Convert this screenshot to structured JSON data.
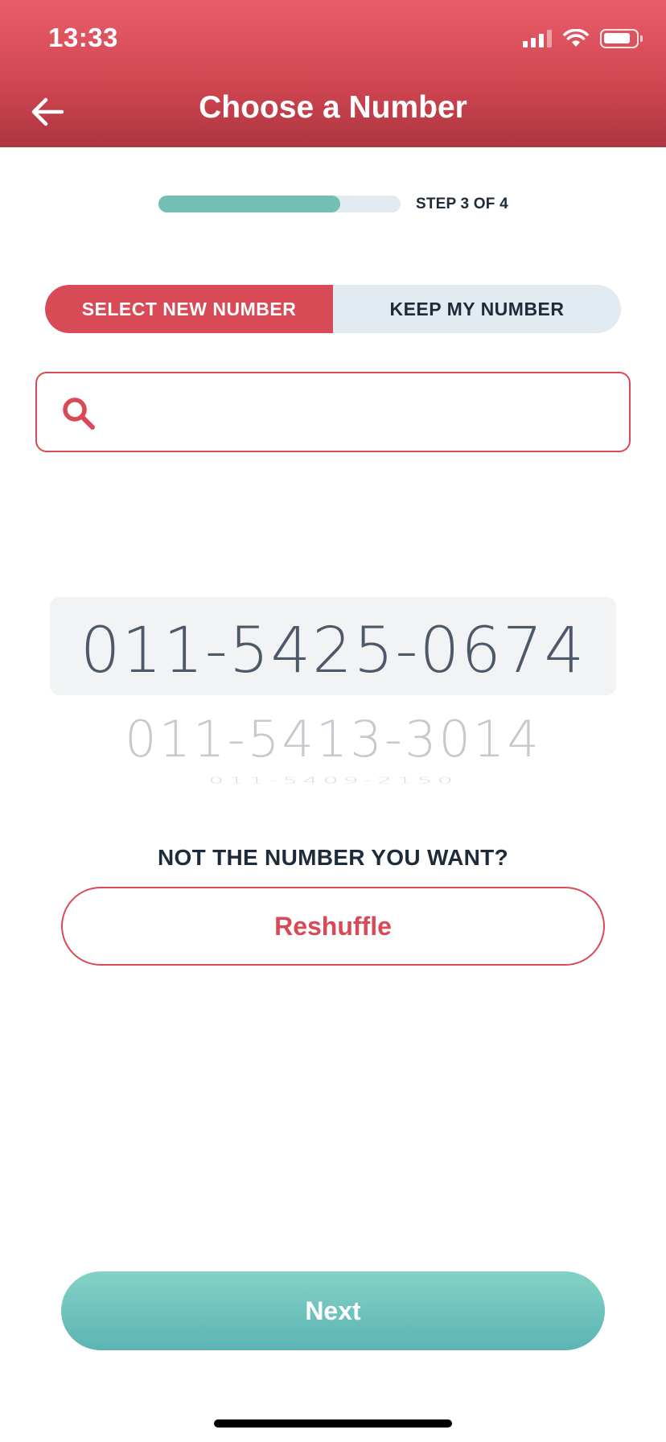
{
  "status_bar": {
    "time": "13:33"
  },
  "header": {
    "title": "Choose a Number"
  },
  "progress": {
    "value": 0.75,
    "step_label": "STEP 3 OF 4"
  },
  "segment": {
    "active_label": "SELECT NEW NUMBER",
    "inactive_label": "KEEP MY NUMBER"
  },
  "search": {
    "value": "",
    "placeholder": ""
  },
  "picker": {
    "numbers": [
      "011-5425-0674",
      "011-5413-3014",
      "011-5409-2150"
    ]
  },
  "reshuffle": {
    "prompt": "NOT THE NUMBER YOU WANT?",
    "button_label": "Reshuffle"
  },
  "next": {
    "label": "Next"
  },
  "colors": {
    "brand_red": "#d84a55",
    "accent_teal": "#73bfb4",
    "text_dark": "#1d2b3a"
  }
}
